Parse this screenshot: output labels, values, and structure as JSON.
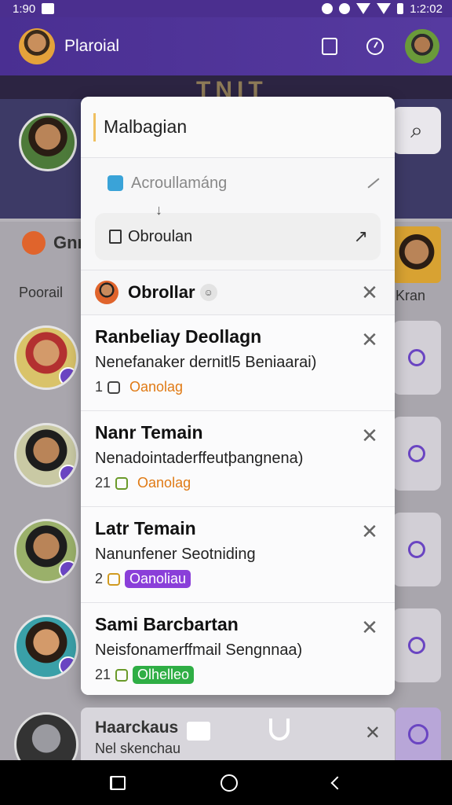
{
  "status_bar": {
    "time": "1:90",
    "clock": "1:2:02"
  },
  "app_bar": {
    "title": "Plaroial"
  },
  "background": {
    "banner_text": "TNIT",
    "section_label": "Gnr",
    "tab_label": "Poorail",
    "right_label": "Kran"
  },
  "panel": {
    "input_value": "Malbagian",
    "suggestion_1": "Acroullamáng",
    "suggestion_2": "Obroulan",
    "group_title": "Obrollar",
    "items": [
      {
        "name": "Ranbeliay Deollagn",
        "desc": "Nenefanaker dernitl5 Beniaarai)",
        "meta": "1",
        "tag": "Oanolag",
        "tag_style": "orange"
      },
      {
        "name": "Nanr Temain",
        "desc": "Nenadointaderffeutþangnena)",
        "meta": "21",
        "tag": "Oanolag",
        "tag_style": "orange"
      },
      {
        "name": "Latr Temain",
        "desc": "Nanunfener Seotniding",
        "meta": "2",
        "tag": "Oanoliau",
        "tag_style": "purple"
      },
      {
        "name": "Sami Barcbartan",
        "desc": "Neisfonamerffmail Sengnnaa)",
        "meta": "21",
        "tag": "Olhelleo",
        "tag_style": "green"
      }
    ]
  },
  "bottom_card": {
    "name": "Haarckaus",
    "desc": "Nel skenchau"
  },
  "colors": {
    "primary": "#4a2f92",
    "accent_purple": "#8a3fd9",
    "accent_green": "#2fae45",
    "accent_orange": "#e07a14"
  }
}
